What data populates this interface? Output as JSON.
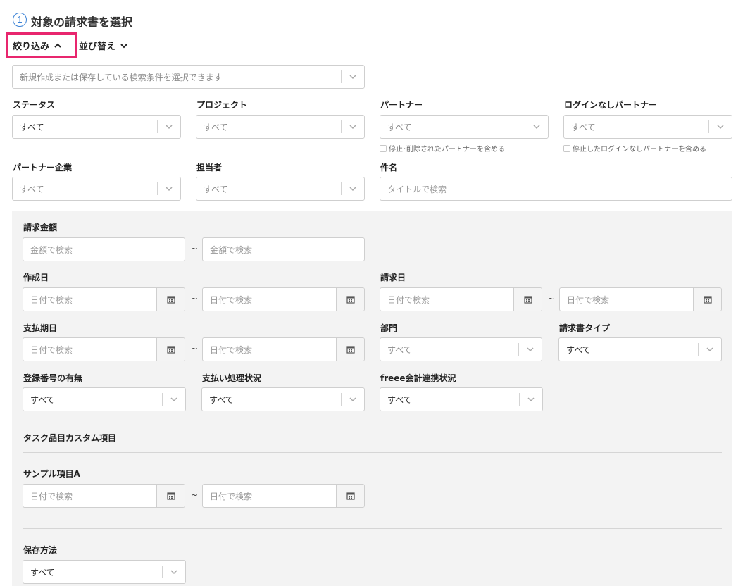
{
  "header": {
    "step_number": "1",
    "title": "対象の請求書を選択"
  },
  "toggles": {
    "filter_label": "絞り込み",
    "sort_label": "並び替え"
  },
  "saved_search": {
    "placeholder": "新規作成または保存している検索条件を選択できます"
  },
  "filters": {
    "status": {
      "label": "ステータス",
      "value": "すべて"
    },
    "project": {
      "label": "プロジェクト",
      "value": "すべて"
    },
    "partner": {
      "label": "パートナー",
      "value": "すべて",
      "checkbox": "停止･削除されたパートナーを含める"
    },
    "nologin_partner": {
      "label": "ログインなしパートナー",
      "value": "すべて",
      "checkbox": "停止したログインなしパートナーを含める"
    },
    "partner_company": {
      "label": "パートナー企業",
      "value": "すべて"
    },
    "assignee": {
      "label": "担当者",
      "value": "すべて"
    },
    "subject": {
      "label": "件名",
      "placeholder": "タイトルで検索"
    }
  },
  "detail": {
    "amount": {
      "label": "請求金額",
      "placeholder": "金額で検索"
    },
    "tilde": "~",
    "created_date": {
      "label": "作成日",
      "placeholder": "日付で検索"
    },
    "invoice_date": {
      "label": "請求日",
      "placeholder": "日付で検索"
    },
    "due_date": {
      "label": "支払期日",
      "placeholder": "日付で検索"
    },
    "department": {
      "label": "部門",
      "value": "すべて"
    },
    "invoice_type": {
      "label": "請求書タイプ",
      "value": "すべて"
    },
    "registration": {
      "label": "登録番号の有無",
      "value": "すべて"
    },
    "payment_status": {
      "label": "支払い処理状況",
      "value": "すべて"
    },
    "freee_status": {
      "label": "freee会計連携状況",
      "value": "すべて"
    },
    "custom_section": "タスク品目カスタム項目",
    "sample_a": {
      "label": "サンプル項目A",
      "placeholder": "日付で検索"
    },
    "storage": {
      "label": "保存方法",
      "value": "すべて"
    }
  },
  "icons": {
    "chevron": "chevron-down-icon",
    "calendar": "calendar-icon",
    "highlight_color": "#e8266e",
    "accent_color": "#3b82d6"
  }
}
